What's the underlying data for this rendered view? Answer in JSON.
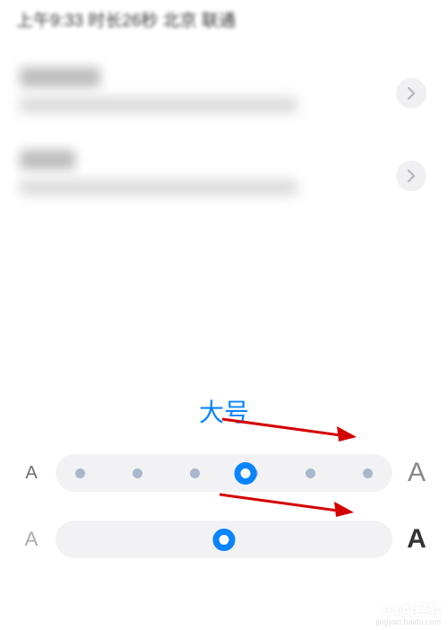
{
  "header": {
    "info": "上午9:33 时长26秒 北京 联通"
  },
  "list": {
    "items": [
      {
        "title": "王小■",
        "subtitle": "2020年1月 周六 上午10时 北京 电信"
      },
      {
        "title": "田芳",
        "subtitle": "2020年1月 周五 上午12时 北京 联通"
      }
    ]
  },
  "font_size": {
    "label": "大号",
    "slider1_value": 4,
    "slider1_ticks": 6,
    "slider2_value": 2,
    "slider2_ticks": 3,
    "left_icon_a": "A",
    "right_icon_a": "A"
  },
  "watermark": {
    "logo": "Bai度经验",
    "url": "jingyan.baidu.com"
  }
}
